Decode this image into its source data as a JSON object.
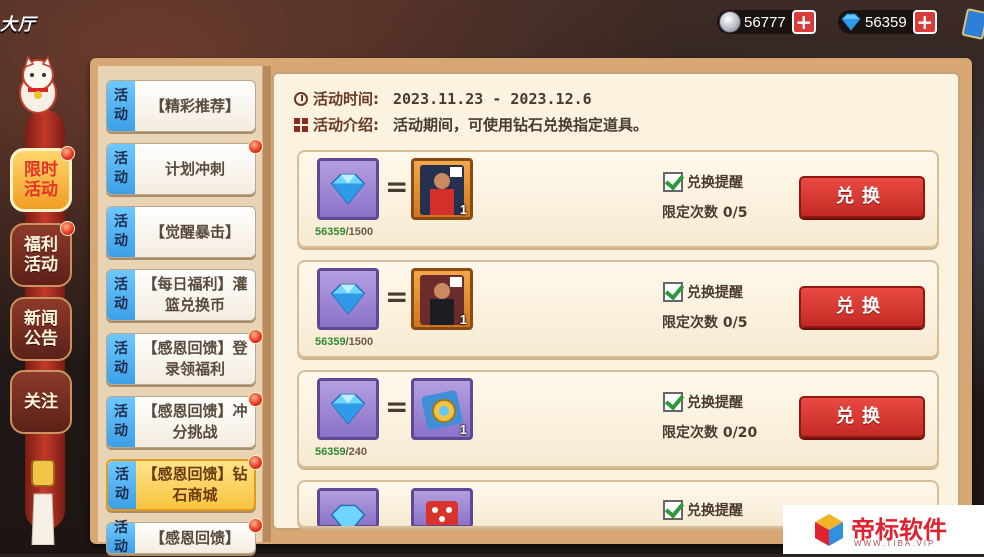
{
  "header": {
    "title": "大厅"
  },
  "currencies": [
    {
      "icon": "silver-coin-icon",
      "value": "56777",
      "plus": "+"
    },
    {
      "icon": "diamond-icon",
      "value": "56359",
      "plus": "+"
    }
  ],
  "side_tabs": [
    {
      "label": "限时活动",
      "active": true,
      "dot": true
    },
    {
      "label": "福利活动",
      "active": false,
      "dot": true
    },
    {
      "label": "新闻公告",
      "active": false,
      "dot": false
    },
    {
      "label": "关注",
      "active": false,
      "dot": false
    }
  ],
  "activities": [
    {
      "badge": "活动",
      "title": "【精彩推荐】",
      "dot": false,
      "selected": false
    },
    {
      "badge": "活动",
      "title": "计划冲刺",
      "dot": true,
      "selected": false
    },
    {
      "badge": "活动",
      "title": "【觉醒暴击】",
      "dot": false,
      "selected": false
    },
    {
      "badge": "活动",
      "title": "【每日福利】灌篮兑换币",
      "dot": false,
      "selected": false
    },
    {
      "badge": "活动",
      "title": "【感恩回馈】登录领福利",
      "dot": true,
      "selected": false
    },
    {
      "badge": "活动",
      "title": "【感恩回馈】冲分挑战",
      "dot": true,
      "selected": false
    },
    {
      "badge": "活动",
      "title": "【感恩回馈】钻石商城",
      "dot": true,
      "selected": true
    },
    {
      "badge": "活动",
      "title": "【感恩回馈】",
      "dot": true,
      "selected": false
    }
  ],
  "info": {
    "time_label": "活动时间:",
    "time_value": "2023.11.23 - 2023.12.6",
    "desc_label": "活动介绍:",
    "desc_value": "活动期间，可使用钻石兑换指定道具。"
  },
  "exchanges": [
    {
      "have": "56359",
      "cost": "/1500",
      "item_frame": "orange",
      "item": "player-card-red-jersey",
      "qty": "1",
      "remind": "兑换提醒",
      "limit": "限定次数 0/5",
      "button": "兑换"
    },
    {
      "have": "56359",
      "cost": "/1500",
      "item_frame": "orange",
      "item": "player-card-black-jersey",
      "qty": "1",
      "remind": "兑换提醒",
      "limit": "限定次数 0/5",
      "button": "兑换"
    },
    {
      "have": "56359",
      "cost": "/240",
      "item_frame": "purple",
      "item": "token-card",
      "qty": "1",
      "remind": "兑换提醒",
      "limit": "限定次数 0/20",
      "button": "兑换"
    },
    {
      "have": "",
      "cost": "",
      "item_frame": "purple",
      "item": "dice-card",
      "qty": "",
      "remind": "兑换提醒",
      "limit": "",
      "button": ""
    }
  ],
  "watermark": {
    "name": "帝标软件",
    "url": "WWW.TIBA.VIP"
  },
  "colors": {
    "accent_red": "#d93a3a",
    "selected_gold": "#f7c43f",
    "badge_blue": "#3d9fe8"
  }
}
